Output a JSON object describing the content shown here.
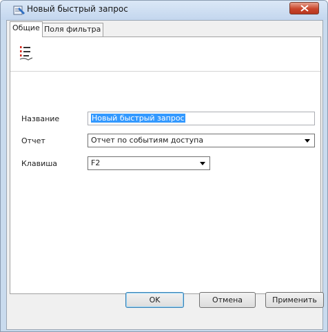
{
  "window": {
    "title": "Новый быстрый запрос"
  },
  "tabs": [
    {
      "label": "Общие",
      "active": true
    },
    {
      "label": "Поля фильтра",
      "active": false
    }
  ],
  "form": {
    "name": {
      "label": "Название",
      "value": "Новый быстрый запрос"
    },
    "report": {
      "label": "Отчет",
      "value": "Отчет по событиям доступа"
    },
    "hotkey": {
      "label": "Клавиша",
      "value": "F2"
    }
  },
  "buttons": {
    "ok": "OK",
    "cancel": "Отмена",
    "apply": "Применить"
  },
  "colors": {
    "selection": "#3399ff",
    "close_button": "#c9462c",
    "title_bar": "#c3d6ee"
  }
}
